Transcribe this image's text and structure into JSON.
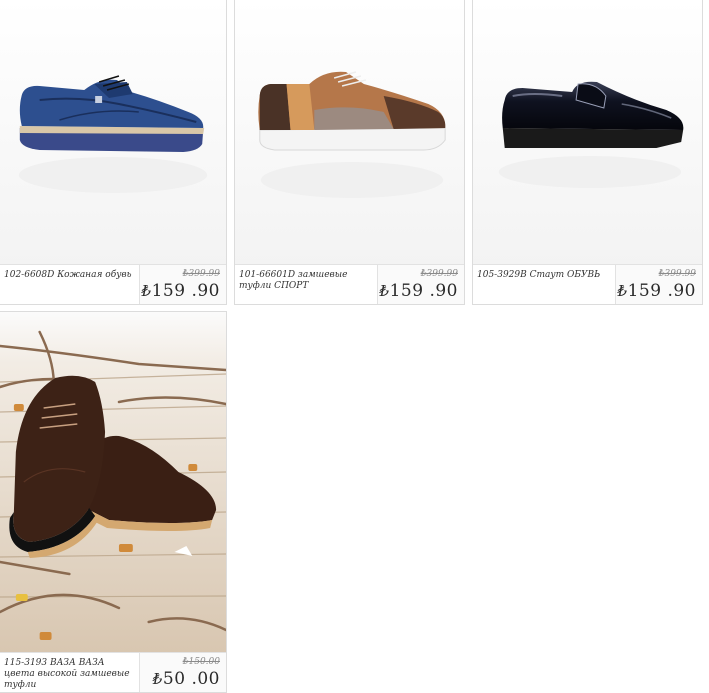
{
  "products": [
    {
      "name": "102-6608D Кожаная обувь",
      "old_price": "₺399.99",
      "currency": "₺",
      "price": "159 .90",
      "image": "blue-suede-brogue-shoe"
    },
    {
      "name": "101-66601D замшевые туфли СПОРТ",
      "old_price": "₺399.99",
      "currency": "₺",
      "price": "159 .90",
      "image": "brown-tan-suede-oxford-shoe"
    },
    {
      "name": "105-3929B Стаут ОБУВЬ",
      "old_price": "₺399.99",
      "currency": "₺",
      "price": "159 .90",
      "image": "black-patent-loafer-shoe"
    },
    {
      "name": "115-3193 ВАЗА ВАЗА цвета высокой замшевые туфли",
      "old_price": "₺150.00",
      "currency": "₺",
      "price": "50 .00",
      "image": "dark-brown-suede-brogues-on-wood"
    }
  ],
  "colors": {
    "border": "#dcdcdc",
    "price_text": "#2a2a2a",
    "old_price_text": "#8a8a8a"
  }
}
